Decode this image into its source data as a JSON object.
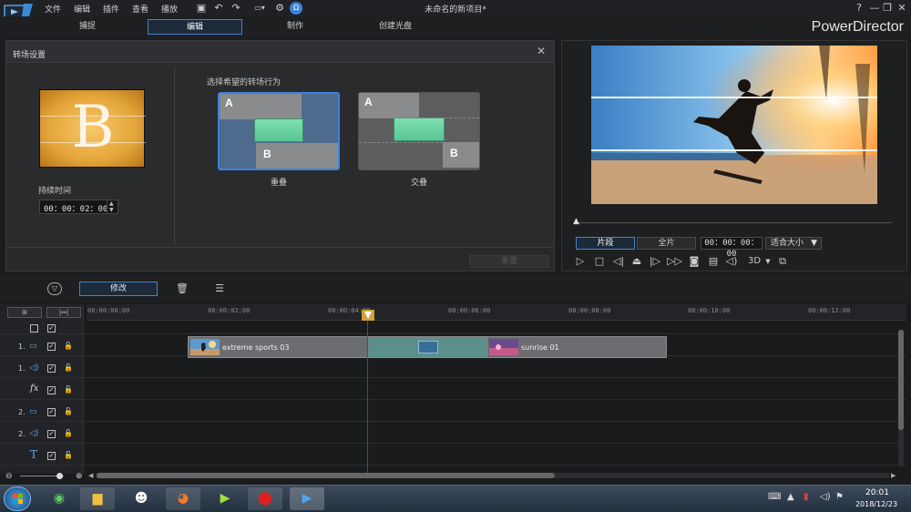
{
  "app": {
    "menu": [
      "文件",
      "编辑",
      "插件",
      "查看",
      "播放"
    ],
    "doc_title": "未命名的新项目*",
    "brand": "PowerDirector",
    "window_controls": [
      "?",
      "—",
      "❐",
      "✕"
    ]
  },
  "modes": {
    "tabs": [
      {
        "label": "捕捉"
      },
      {
        "label": "编辑",
        "active": true
      },
      {
        "label": "制作"
      },
      {
        "label": "创建光盘"
      }
    ]
  },
  "transition": {
    "title": "转场设置",
    "preview_letter": "B",
    "duration_label": "持续时间",
    "duration_value": "00：00：02：00",
    "behavior_label": "选择希望的转场行为",
    "option_overlap": {
      "label": "重叠",
      "a": "A",
      "b": "B",
      "selected": true
    },
    "option_cross": {
      "label": "交叠",
      "a": "A",
      "b": "B"
    },
    "reset_label": "重置"
  },
  "preview": {
    "clip_label": "片段",
    "full_label": "全片",
    "time_value": "00：00：00：00",
    "fit_label": "适合大小",
    "mode_3d": "3D"
  },
  "timeline_toolbar": {
    "modify_label": "修改"
  },
  "timeline": {
    "ticks": [
      "00:00:00:00",
      "00:00:02:00",
      "00:00:04:00",
      "00:00:06:00",
      "00:00:08:00",
      "00:00:10:00",
      "00:00:12:00"
    ],
    "tracks": [
      {
        "num": "1.",
        "icon": "video-track-icon"
      },
      {
        "num": "1.",
        "icon": "audio-track-icon"
      },
      {
        "num": "",
        "icon": "fx-track-icon",
        "symbol": "fx"
      },
      {
        "num": "2.",
        "icon": "video-track-icon"
      },
      {
        "num": "2.",
        "icon": "audio-track-icon"
      },
      {
        "num": "",
        "icon": "title-track-icon",
        "symbol": "T"
      }
    ],
    "clips": [
      {
        "name": "extreme sports 03"
      },
      {
        "name": "sunrise 01"
      }
    ]
  },
  "taskbar": {
    "time": "20:01",
    "date": "2018/12/23"
  },
  "colors": {
    "accent": "#4a82c4",
    "selected_border": "#3b82e0",
    "playhead": "#c02020",
    "transition_green": "#6fd4a2"
  }
}
